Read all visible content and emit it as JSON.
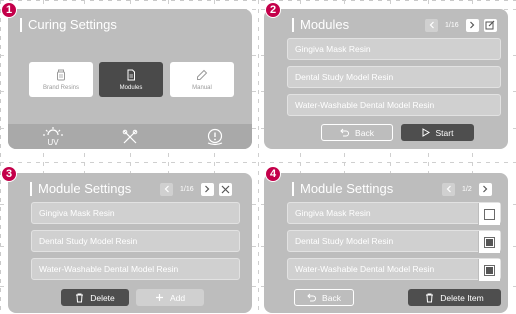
{
  "badges": [
    "1",
    "2",
    "3",
    "4"
  ],
  "panel1": {
    "title": "Curing Settings",
    "modes": [
      {
        "label": "Brand Resins",
        "icon": "resin-bottle-icon"
      },
      {
        "label": "Modules",
        "icon": "document-icon"
      },
      {
        "label": "Manual",
        "icon": "pencil-icon"
      }
    ],
    "selected_mode": "Modules",
    "bottom_bar": {
      "uv_label": "UV",
      "tools_icon": "tools-icon",
      "support_icon": "support-icon"
    }
  },
  "panel2": {
    "title": "Modules",
    "pager": "1/16",
    "items": [
      "Gingiva Mask Resin",
      "Dental Study Model Resin",
      "Water-Washable Dental Model Resin"
    ],
    "back_label": "Back",
    "start_label": "Start"
  },
  "panel3": {
    "title": "Module Settings",
    "pager": "1/16",
    "items": [
      "Gingiva Mask Resin",
      "Dental Study Model Resin",
      "Water-Washable Dental Model Resin"
    ],
    "delete_label": "Delete",
    "add_label": "Add"
  },
  "panel4": {
    "title": "Module Settings",
    "pager": "1/2",
    "items": [
      {
        "label": "Gingiva Mask Resin",
        "checked": false
      },
      {
        "label": "Dental Study Model Resin",
        "checked": true
      },
      {
        "label": "Water-Washable Dental Model Resin",
        "checked": true
      }
    ],
    "back_label": "Back",
    "delete_item_label": "Delete Item"
  },
  "colors": {
    "badge": "#c4004a",
    "panel": "#bdbdbd",
    "dark_button": "#4e4e4e"
  }
}
